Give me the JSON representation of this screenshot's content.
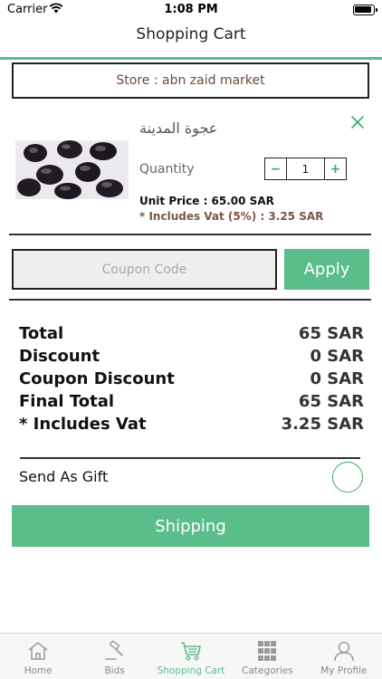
{
  "status_bar": {
    "carrier": "Carrier",
    "time": "1:08 PM"
  },
  "header": {
    "title": "Shopping Cart"
  },
  "store": {
    "label": "Store : abn zaid market"
  },
  "cart_item": {
    "name": "عجوة المدينة",
    "quantity_label": "Quantity",
    "quantity": "1",
    "minus_symbol": "−",
    "plus_symbol": "+",
    "unit_price": "Unit Price : 65.00 SAR",
    "vat": "* Includes Vat (5%) : 3.25 SAR"
  },
  "coupon": {
    "placeholder": "Coupon Code",
    "apply_label": "Apply"
  },
  "summary": {
    "rows": [
      {
        "label": "Total",
        "value": "65 SAR"
      },
      {
        "label": "Discount",
        "value": "0 SAR"
      },
      {
        "label": "Coupon Discount",
        "value": "0 SAR"
      },
      {
        "label": "Final Total",
        "value": "65 SAR"
      },
      {
        "label": "* Includes Vat",
        "value": "3.25 SAR"
      }
    ]
  },
  "gift": {
    "label": "Send As Gift",
    "checked": false
  },
  "shipping_button": {
    "label": "Shipping"
  },
  "tab_bar": {
    "active": "Shopping Cart",
    "items": [
      {
        "label": "Home",
        "icon": "home-icon"
      },
      {
        "label": "Bids",
        "icon": "gavel-icon"
      },
      {
        "label": "Shopping Cart",
        "icon": "cart-icon"
      },
      {
        "label": "Categories",
        "icon": "grid-icon"
      },
      {
        "label": "My Profile",
        "icon": "person-icon"
      }
    ]
  },
  "colors": {
    "accent": "#5bbd8a",
    "accent_dark": "#3daa66",
    "store_text": "#6b4a3a",
    "vat_text": "#7a5545"
  }
}
